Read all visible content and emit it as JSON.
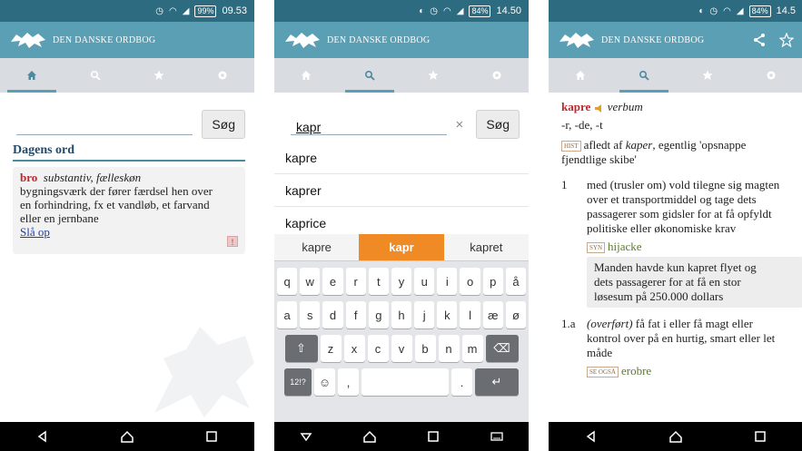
{
  "app": {
    "title": "DEN DANSKE ORDBOG"
  },
  "colors": {
    "statusbar": "#2d6b80",
    "appbar": "#5b9fb5",
    "tabbar": "#d9dde1",
    "accent_tab": "#5b9fb5",
    "headword": "#c0272d",
    "section_header": "#234a6a",
    "link": "#1a3fa8",
    "keyboard_selected": "#f08a24"
  },
  "screen1": {
    "status": {
      "battery": "99%",
      "time": "09.53"
    },
    "search": {
      "value": "",
      "button": "Søg"
    },
    "daily": {
      "header": "Dagens ord",
      "headword": "bro",
      "pos": "substantiv, fælleskøn",
      "definition_lines": [
        "bygningsværk der fører færdsel hen over",
        "en forhindring, fx et vandløb, et farvand",
        "eller en jernbane"
      ],
      "link": "Slå op",
      "flag_icon": "!"
    }
  },
  "screen2": {
    "status": {
      "battery": "84%",
      "time": "14.50"
    },
    "search": {
      "value": "kapr",
      "clear_icon": "×",
      "button": "Søg"
    },
    "suggestions": [
      "kapre",
      "kaprer",
      "kaprice"
    ],
    "keyboard": {
      "candidates": [
        "kapre",
        "kapr",
        "kapret"
      ],
      "row1": [
        "q",
        "w",
        "e",
        "r",
        "t",
        "y",
        "u",
        "i",
        "o",
        "p",
        "å"
      ],
      "row2": [
        "a",
        "s",
        "d",
        "f",
        "g",
        "h",
        "j",
        "k",
        "l",
        "æ",
        "ø"
      ],
      "row3": [
        "z",
        "x",
        "c",
        "v",
        "b",
        "n",
        "m"
      ],
      "shift_icon": "⇧",
      "backspace_icon": "⌫",
      "symbols_key": "12!?",
      "emoji_icon": "☺",
      "comma": ",",
      "period": ".",
      "enter_icon": "↵"
    }
  },
  "screen3": {
    "status": {
      "battery": "84%",
      "time": "14.5"
    },
    "entry": {
      "headword": "kapre",
      "pos": "verbum",
      "inflection": "-r, -de, -t",
      "hist_tag": "HIST",
      "hist_line1_pre": "afledt af ",
      "hist_line1_word": "kaper",
      "hist_line1_post": ", egentlig 'opsnappe",
      "hist_line2": "fjendtlige skibe'",
      "sense1": {
        "num": "1",
        "lines": [
          "med (trusler om) vold tilegne sig magten",
          "over et transportmiddel og tage dets",
          "passagerer som gidsler for at få opfyldt",
          "politiske eller økonomiske krav"
        ],
        "syn_tag": "SYN",
        "syn": "hijacke",
        "example_lines": [
          "Manden havde kun kapret flyet og",
          "dets passagerer for at få en stor",
          "løsesum på 250.000 dollars"
        ]
      },
      "sense2": {
        "num": "1.a",
        "label": "(overført)",
        "lines_first": " få fat i eller få magt eller",
        "lines": [
          "kontrol over på en hurtig, smart eller let",
          "måde"
        ],
        "see_tag": "SE OGSÅ",
        "see": "erobre"
      }
    }
  }
}
